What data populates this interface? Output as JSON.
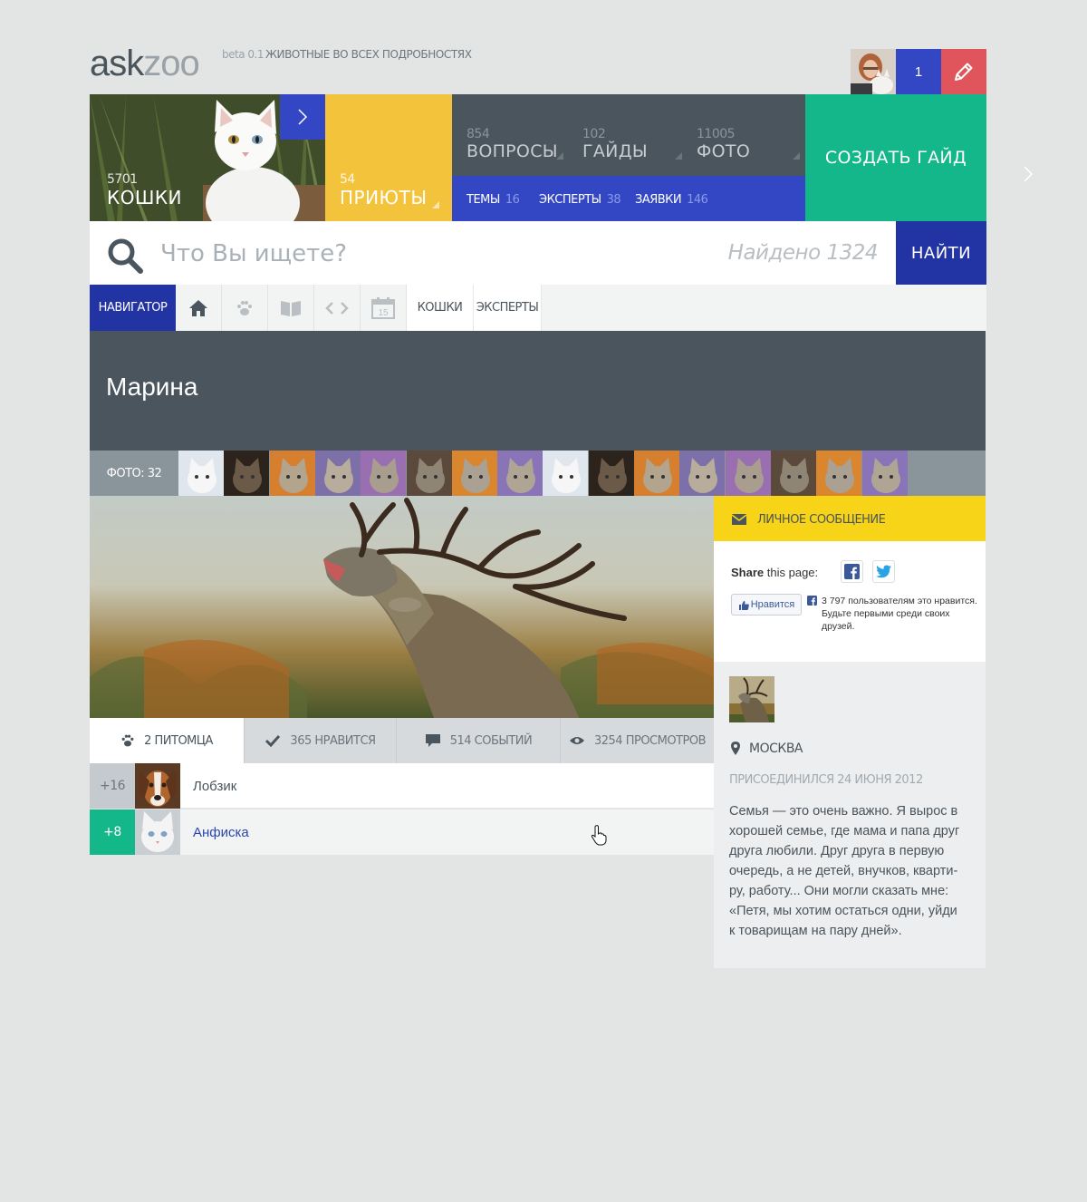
{
  "header": {
    "logo_part1": "ask",
    "logo_part2": "zoo",
    "beta": "beta 0.1",
    "tagline": "ЖИВОТНЫЕ ВО ВСЕХ ПОДРОБНОСТЯХ",
    "notifications_count": "1"
  },
  "tiles": {
    "cats": {
      "count": "5701",
      "label": "КОШКИ"
    },
    "shelters": {
      "count": "54",
      "label": "ПРИЮТЫ"
    },
    "stats": [
      {
        "count": "854",
        "label": "ВОПРОСЫ"
      },
      {
        "count": "102",
        "label": "ГАЙДЫ"
      },
      {
        "count": "11005",
        "label": "ФОТО"
      }
    ],
    "sub": [
      {
        "label": "ТЕМЫ",
        "count": "16"
      },
      {
        "label": "ЭКСПЕРТЫ",
        "count": "38"
      },
      {
        "label": "ЗАЯВКИ",
        "count": "146"
      }
    ],
    "create_guide": "СОЗДАТЬ ГАЙД"
  },
  "search": {
    "placeholder": "Что Вы ищете?",
    "found": "Найдено 1324",
    "button": "НАЙТИ"
  },
  "navigator": {
    "label": "НАВИГАТОР",
    "icons": [
      "home-icon",
      "paw-icon",
      "book-icon",
      "code-icon",
      "calendar-icon"
    ],
    "calendar_day": "15",
    "links": [
      "КОШКИ",
      "ЭКСПЕРТЫ"
    ]
  },
  "profile": {
    "name": "Марина",
    "photo_count": "ФОТО: 32",
    "tabs": [
      {
        "icon": "paw-icon",
        "label": "2 ПИТОМЦА"
      },
      {
        "icon": "check-icon",
        "label": "365 НРАВИТСЯ"
      },
      {
        "icon": "comment-icon",
        "label": "514 СОБЫТИЙ"
      },
      {
        "icon": "eye-icon",
        "label": "3254 ПРОСМОТРОВ"
      }
    ],
    "pets": [
      {
        "score": "+16",
        "name": "Лобзик"
      },
      {
        "score": "+8",
        "name": "Анфиска"
      }
    ]
  },
  "sidebar": {
    "message_button": "ЛИЧНОЕ СООБЩЕНИЕ",
    "share_label": "Share",
    "share_rest": "this page:",
    "like_button": "Нравится",
    "like_text": "3 797 пользователям это нравится. Будьте первыми среди своих друзей.",
    "city": "МОСКВА",
    "joined": "ПРИСОЕДИНИЛСЯ 24 ИЮНЯ 2012",
    "bio": "Семья — это очень важно. Я вырос в хорошей семье, где мама и папа друг друга любили. Друг друга в первую очередь, а не детей, внучков, кварти-ру, работу... Они могли сказать мне: «Петя, мы хотим остаться одни, уйди к товарищам на пару дней»."
  },
  "colors": {
    "blue": "#3347c5",
    "dark_blue": "#2233a4",
    "yellow": "#f3c33c",
    "green": "#13b78a",
    "red": "#e0545c",
    "slate": "#4a555e",
    "message_yellow": "#f7d417"
  }
}
